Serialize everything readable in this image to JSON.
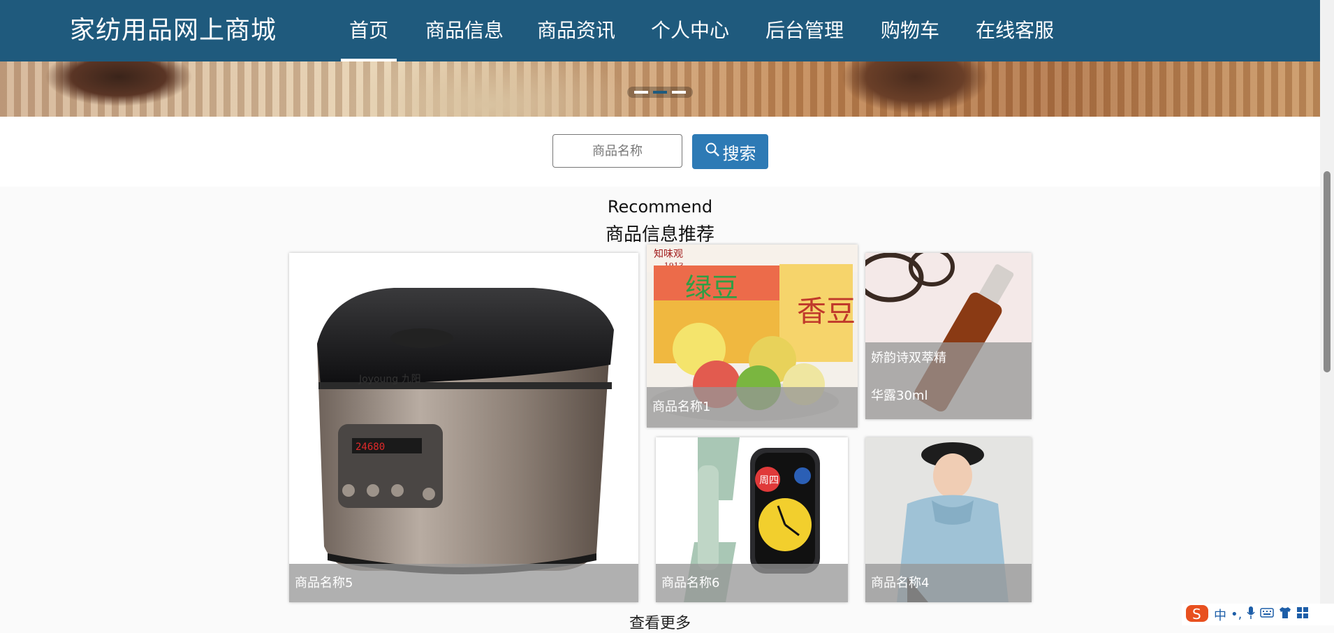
{
  "header": {
    "site_title": "家纺用品网上商城",
    "nav": [
      "首页",
      "商品信息",
      "商品资讯",
      "个人中心",
      "后台管理",
      "购物车",
      "在线客服"
    ],
    "active_index": 0
  },
  "search": {
    "placeholder": "商品名称",
    "button_label": "搜索"
  },
  "section": {
    "title_en": "Recommend",
    "title_cn": "商品信息推荐"
  },
  "products": [
    {
      "name": "商品名称5",
      "icon": "rice-cooker-image"
    },
    {
      "name": "商品名称1",
      "icon": "mooncake-box-image"
    },
    {
      "name": "娇韵诗双萃精华露30ml",
      "name_line1": "娇韵诗双萃精",
      "name_line2": "华露30ml",
      "icon": "serum-bottle-image"
    },
    {
      "name": "商品名称6",
      "icon": "smart-watch-image"
    },
    {
      "name": "商品名称4",
      "icon": "hoodie-model-image"
    }
  ],
  "more_label": "查看更多",
  "ime": {
    "mode": "中"
  },
  "colors": {
    "nav_bg": "#1f5a7d",
    "button_bg": "#2d7ab5"
  }
}
